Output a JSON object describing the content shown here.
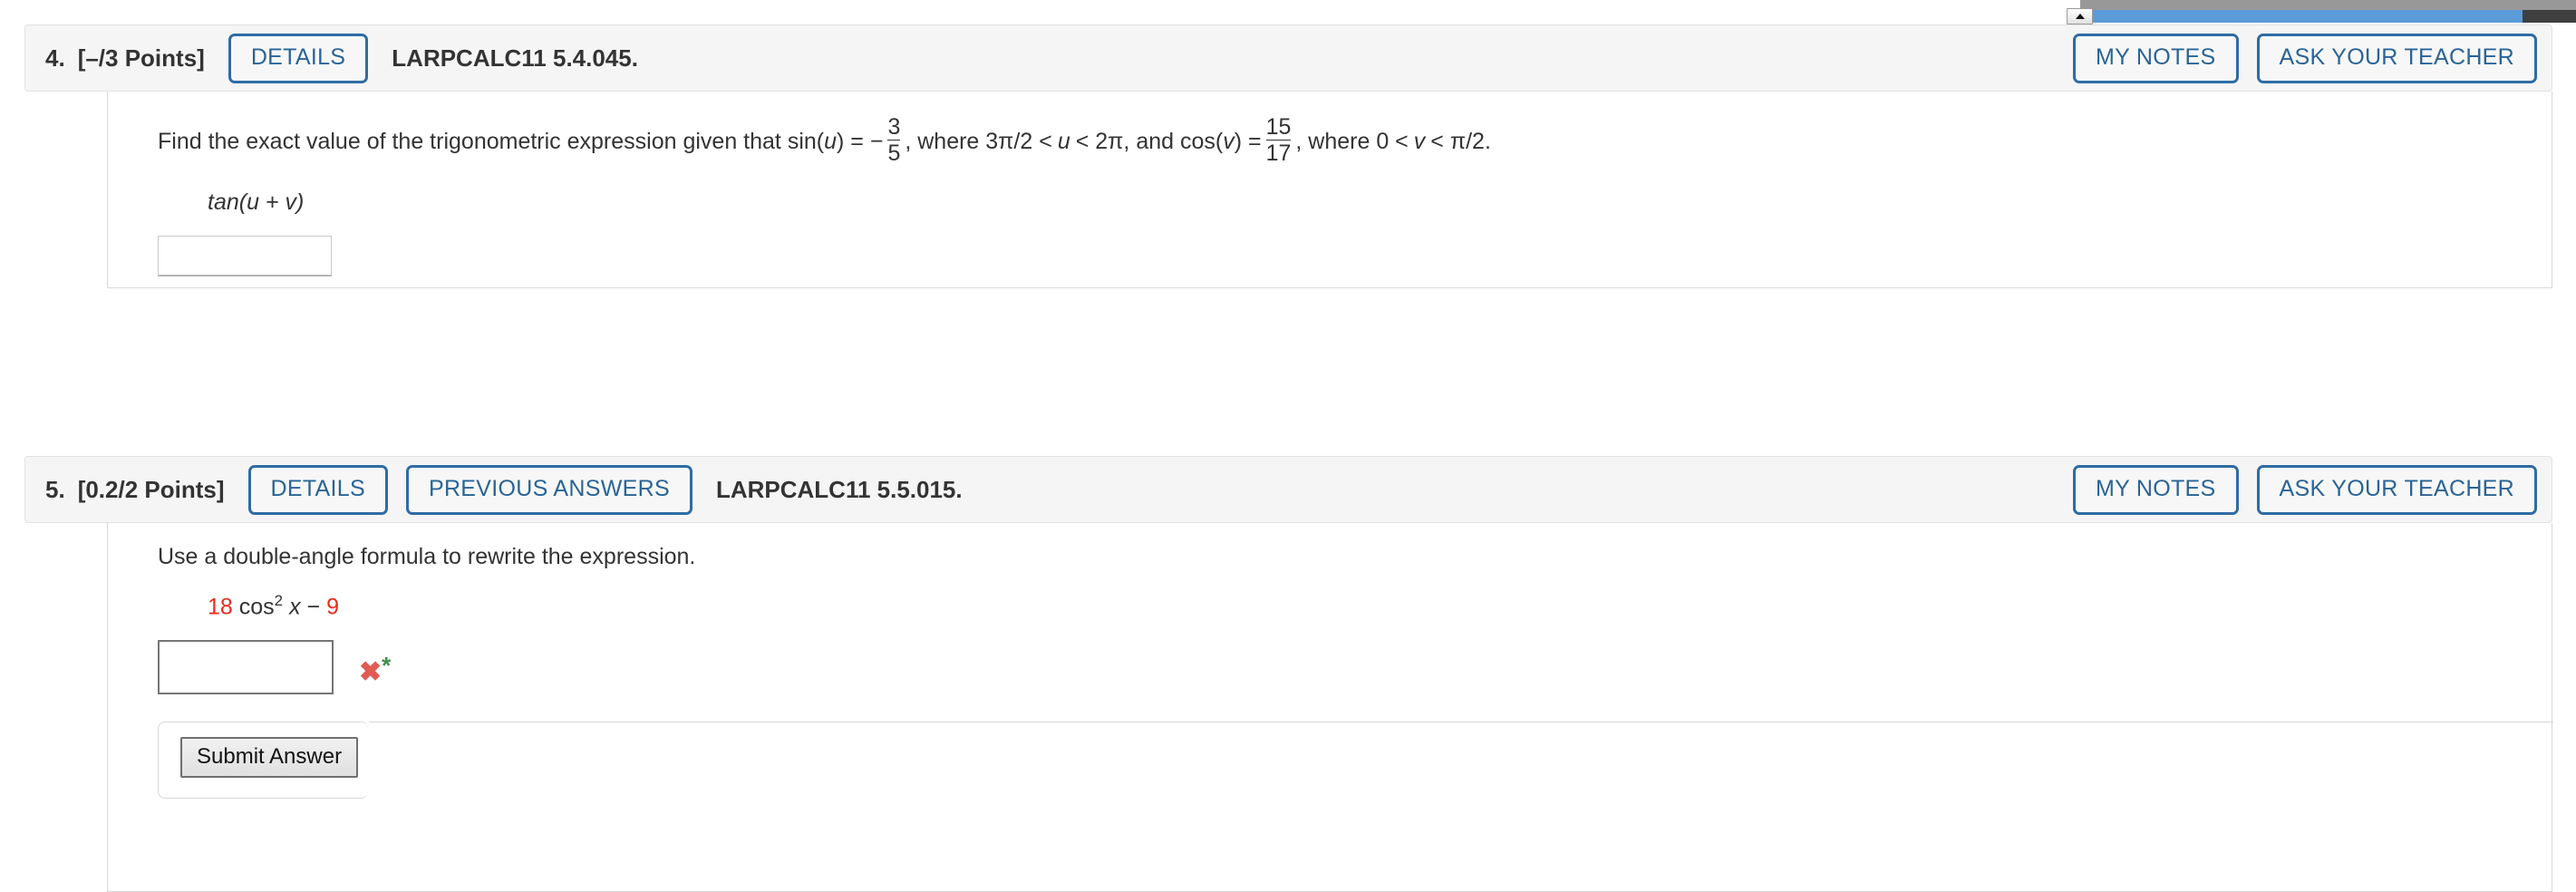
{
  "scrollbar": {
    "arrow_icon": "triangle-up-icon"
  },
  "questions": [
    {
      "number": "4.",
      "points": "[–/3 Points]",
      "details_label": "DETAILS",
      "textbook_ref": "LARPCALC11 5.4.045.",
      "my_notes_label": "MY NOTES",
      "ask_teacher_label": "ASK YOUR TEACHER",
      "prompt_part1": "Find the exact value of the trigonometric expression given that sin(",
      "prompt_var1": "u",
      "prompt_part2": ") = −",
      "frac1_num": "3",
      "frac1_den": "5",
      "prompt_part3": ", where 3π/2 <",
      "prompt_var2": "u",
      "prompt_part4": "< 2π, and cos(",
      "prompt_var3": "v",
      "prompt_part5": ") =",
      "frac2_num": "15",
      "frac2_den": "17",
      "prompt_part6": ", where 0 <",
      "prompt_var4": "v",
      "prompt_part7": "< π/2.",
      "expression": "tan(u + v)",
      "answer_value": ""
    },
    {
      "number": "5.",
      "points": "[0.2/2 Points]",
      "details_label": "DETAILS",
      "previous_answers_label": "PREVIOUS ANSWERS",
      "textbook_ref": "LARPCALC11 5.5.015.",
      "my_notes_label": "MY NOTES",
      "ask_teacher_label": "ASK YOUR TEACHER",
      "prompt": "Use a double-angle formula to rewrite the expression.",
      "expr_coef": "18",
      "expr_fn": "cos",
      "expr_power": "2",
      "expr_var": "x",
      "expr_op": "−",
      "expr_const": "9",
      "answer_value": "",
      "incorrect_mark": "✖",
      "star_mark": "*",
      "submit_label": "Submit Answer"
    }
  ],
  "colors": {
    "accent_blue": "#2a6496",
    "border_blue": "#2e6ca4",
    "red_highlight": "#ED2B1C",
    "incorrect_red": "#e05c52",
    "star_green": "#3f8f4a",
    "header_bg": "#f5f5f5",
    "scroll_thumb": "#5b9bd9"
  }
}
